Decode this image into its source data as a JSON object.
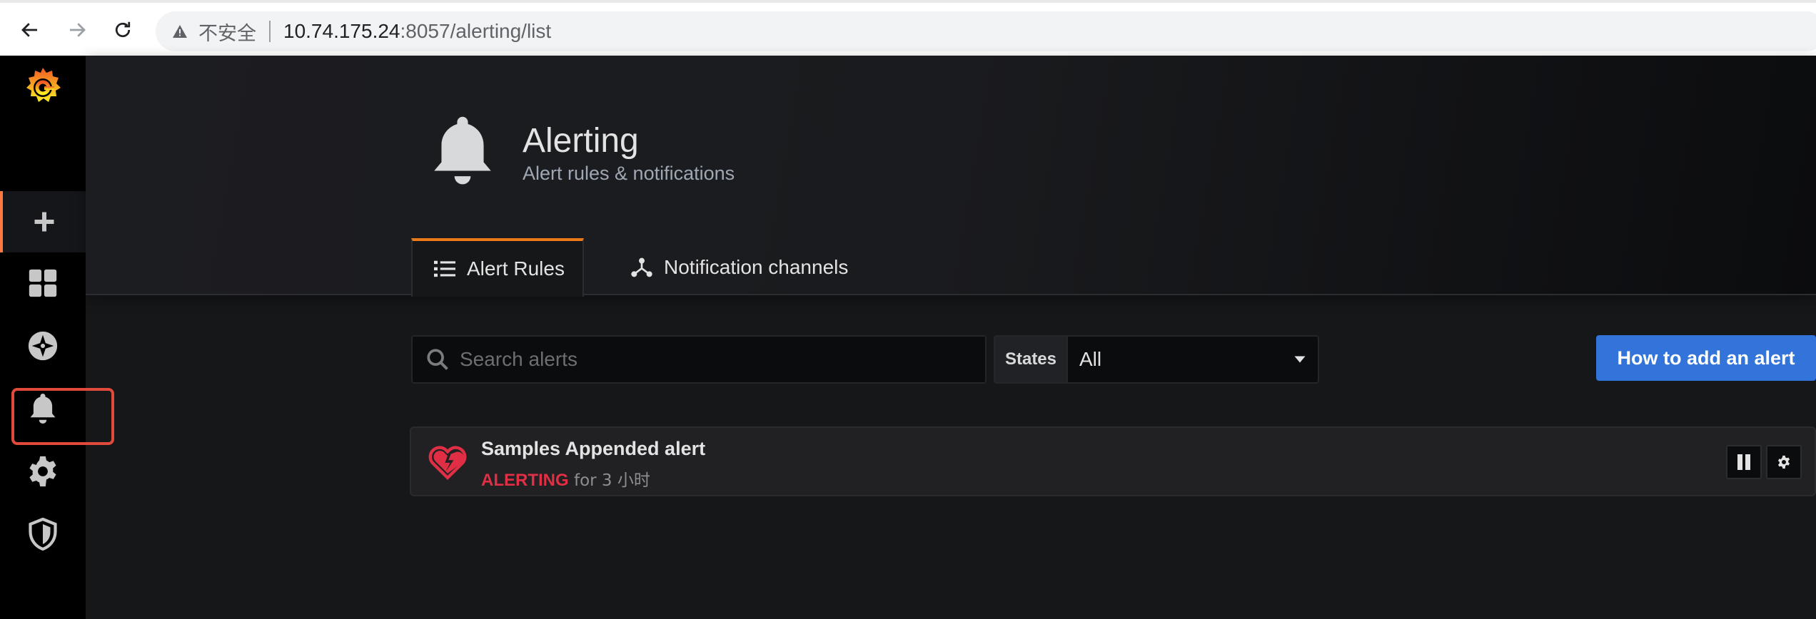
{
  "browser": {
    "not_secure_label": "不安全",
    "url_host": "10.74.175.24",
    "url_rest": ":8057/alerting/list"
  },
  "sidebar": {
    "items": [
      {
        "name": "grafana-logo-icon"
      },
      {
        "name": "create-plus-icon"
      },
      {
        "name": "dashboards-icon"
      },
      {
        "name": "explore-icon"
      },
      {
        "name": "alerting-bell-icon"
      },
      {
        "name": "configuration-gear-icon"
      },
      {
        "name": "server-admin-shield-icon"
      }
    ],
    "accent_color": "#ff7941",
    "highlight_color": "#e04a3a"
  },
  "header": {
    "icon": "bell-icon",
    "title": "Alerting",
    "subtitle": "Alert rules & notifications"
  },
  "tabs": [
    {
      "label": "Alert Rules",
      "icon": "list-icon",
      "active": true
    },
    {
      "label": "Notification channels",
      "icon": "channels-icon",
      "active": false
    }
  ],
  "filters": {
    "search_placeholder": "Search alerts",
    "states_label": "States",
    "states_value": "All"
  },
  "actions": {
    "add_alert_label": "How to add an alert",
    "button_color": "#3274d9"
  },
  "alerts": [
    {
      "name": "Samples Appended alert",
      "state": "ALERTING",
      "duration": "for 3 小时",
      "state_color": "#e02f44",
      "icon": "broken-heart-icon"
    }
  ]
}
